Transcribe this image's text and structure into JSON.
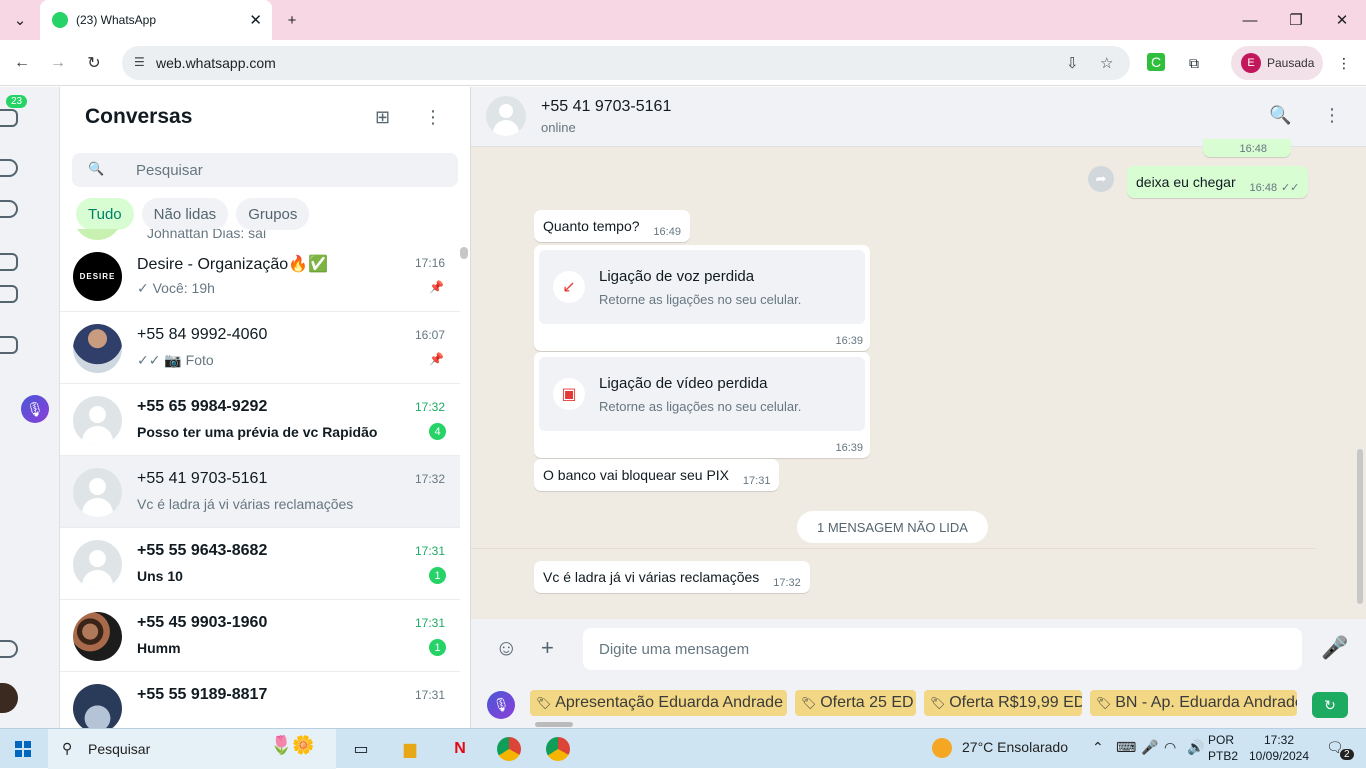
{
  "browser": {
    "tab_title": "(23) WhatsApp",
    "url": "web.whatsapp.com",
    "profile_initial": "E",
    "profile_label": "Pausada"
  },
  "rail": {
    "badge": "23"
  },
  "sidebar": {
    "title": "Conversas",
    "search_placeholder": "Pesquisar",
    "filters": [
      "Tudo",
      "Não lidas",
      "Grupos"
    ],
    "partial_row_text": "Johnattan Dias: sai",
    "chats": [
      {
        "name": "Desire - Organização🔥✅",
        "time": "17:16",
        "msg": "✓ Você: 19h",
        "pinned": true,
        "avatar_text": "DESIRE"
      },
      {
        "name": "+55 84 9992-4060",
        "time": "16:07",
        "msg": "✓✓ 📷 Foto",
        "pinned": true
      },
      {
        "name": "+55 65 9984-9292",
        "time": "17:32",
        "msg": "Posso ter uma prévia de vc Rapidão",
        "unread": "4"
      },
      {
        "name": "+55 41 9703-5161",
        "time": "17:32",
        "msg": "Vc é ladra já vi várias reclamações",
        "selected": true
      },
      {
        "name": "+55 55 9643-8682",
        "time": "17:31",
        "msg": "Uns 10",
        "unread": "1"
      },
      {
        "name": "+55 45 9903-1960",
        "time": "17:31",
        "msg": "Humm",
        "unread": "1"
      },
      {
        "name": "+55 55 9189-8817",
        "time": "17:31",
        "msg": ""
      }
    ]
  },
  "chat": {
    "contact": "+55 41 9703-5161",
    "status": "online",
    "messages": {
      "top_partial_time": "16:48",
      "out1_text": "deixa eu chegar",
      "out1_time": "16:48",
      "in1_text": "Quanto tempo?",
      "in1_time": "16:49",
      "call1_label": "Ligação de voz perdida",
      "call1_sub": "Retorne as ligações no seu celular.",
      "call1_time": "16:39",
      "call2_label": "Ligação de vídeo perdida",
      "call2_sub": "Retorne as ligações no seu celular.",
      "call2_time": "16:39",
      "in2_text": "O banco vai bloquear seu PIX",
      "in2_time": "17:31",
      "unread_divider": "1 MENSAGEM NÃO LIDA",
      "in3_text": "Vc é ladra já vi várias reclamações",
      "in3_time": "17:32"
    },
    "composer_placeholder": "Digite uma mensagem",
    "quick_replies": [
      "Apresentação Eduarda Andrade",
      "Oferta 25 ED",
      "Oferta R$19,99 ED",
      "BN - Ap. Eduarda Andrade"
    ]
  },
  "taskbar": {
    "search": "Pesquisar",
    "weather": "27°C  Ensolarado",
    "lang1": "POR",
    "lang2": "PTB2",
    "time": "17:32",
    "date": "10/09/2024",
    "notif": "2"
  }
}
